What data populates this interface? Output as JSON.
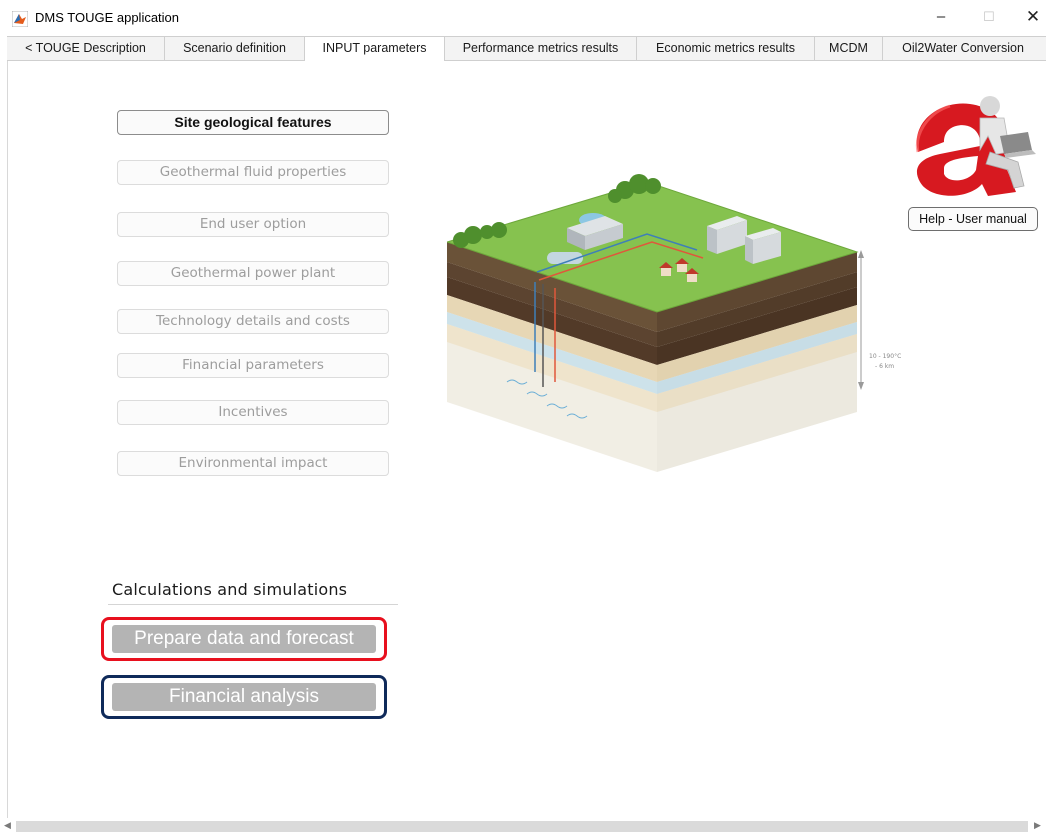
{
  "window": {
    "title": "DMS TOUGE application",
    "minimize": "–",
    "maximize": "☐",
    "close": "✕"
  },
  "tabs": [
    {
      "label": "< TOUGE Description",
      "active": false
    },
    {
      "label": "Scenario definition",
      "active": false
    },
    {
      "label": "INPUT parameters",
      "active": true
    },
    {
      "label": "Performance metrics results",
      "active": false
    },
    {
      "label": "Economic metrics results",
      "active": false
    },
    {
      "label": "MCDM",
      "active": false
    },
    {
      "label": "Oil2Water Conversion",
      "active": false
    }
  ],
  "parameters": [
    {
      "label": "Site geological features",
      "active": true
    },
    {
      "label": "Geothermal fluid properties",
      "active": false
    },
    {
      "label": "End user option",
      "active": false
    },
    {
      "label": "Geothermal power plant",
      "active": false
    },
    {
      "label": "Technology details and costs",
      "active": false
    },
    {
      "label": "Financial parameters",
      "active": false
    },
    {
      "label": "Incentives",
      "active": false
    },
    {
      "label": "Environmental impact",
      "active": false
    }
  ],
  "calculations": {
    "title": "Calculations and simulations",
    "prepare_label": "Prepare data and forecast",
    "financial_label": "Financial analysis"
  },
  "help": {
    "button_label": "Help - User manual"
  },
  "illustration": {
    "depth_label_1": "10 - 190°C",
    "depth_label_2": "- 6 km"
  },
  "colors": {
    "prepare_frame": "#e8101e",
    "financial_frame": "#0f2a5a",
    "calc_button_bg": "#b4b4b4"
  }
}
